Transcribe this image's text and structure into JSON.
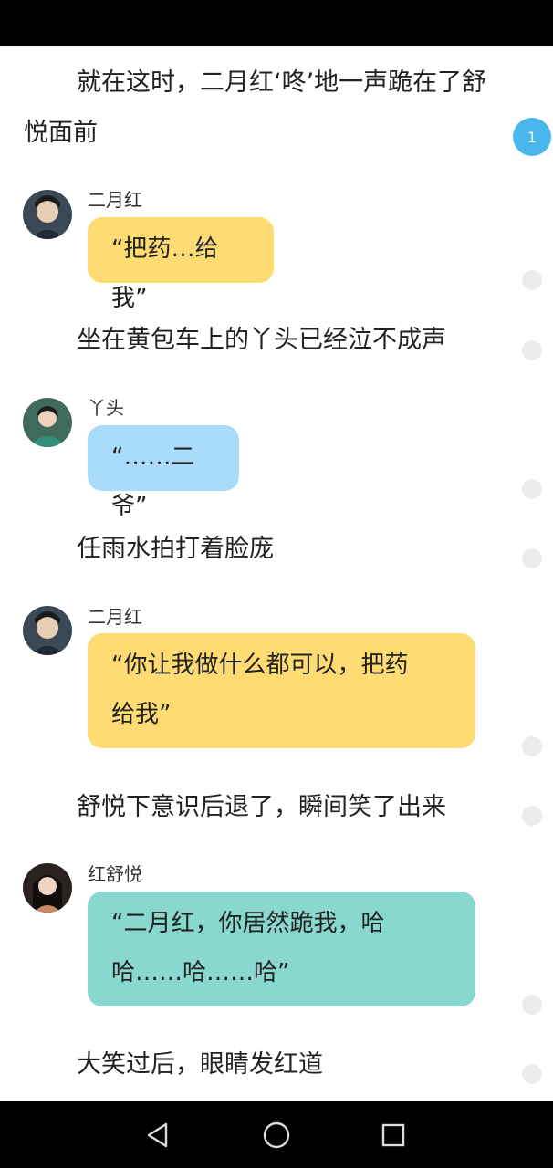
{
  "story": {
    "para1_line1": "就在这时，二月红‘咚’地一声跪在了舒",
    "para1_line2": "悦面前",
    "comment_badge": "1",
    "msg1": {
      "speaker": "二月红",
      "text": "“把药…给我”"
    },
    "narr2": "坐在黄包车上的丫头已经泣不成声",
    "msg2": {
      "speaker": "丫头",
      "text": "“……二爷”"
    },
    "narr3": "任雨水拍打着脸庞",
    "msg3": {
      "speaker": "二月红",
      "line1": "“你让我做什么都可以，把药",
      "line2": "给我”"
    },
    "narr4": "舒悦下意识后退了，瞬间笑了出来",
    "msg4": {
      "speaker": "红舒悦",
      "line1": "“二月红，你居然跪我，哈",
      "line2": "哈……哈……哈”"
    },
    "narr5": "大笑过后，眼睛发红道"
  },
  "colors": {
    "bubble_yellow": "#ffdc73",
    "bubble_blue": "#a9dcfb",
    "bubble_teal": "#88d8cf",
    "badge_blue": "#4ab7ec"
  },
  "nav": {
    "back_icon": "back-triangle-icon",
    "home_icon": "home-circle-icon",
    "recents_icon": "recents-square-icon"
  }
}
